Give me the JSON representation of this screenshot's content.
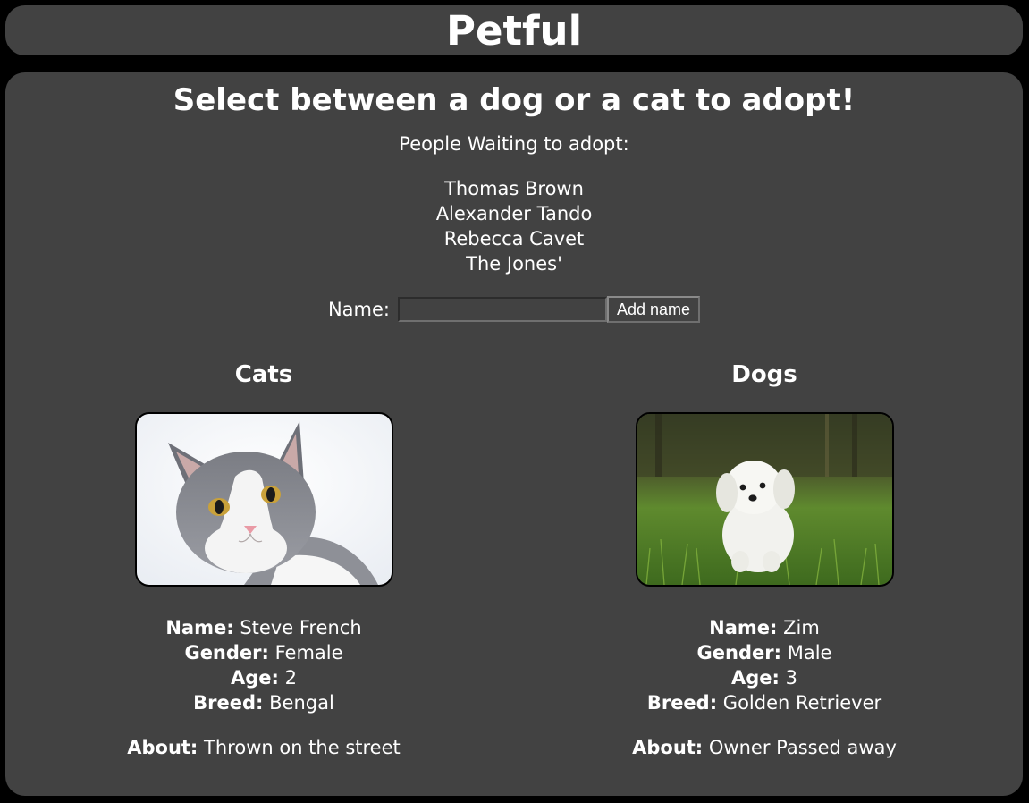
{
  "header": {
    "title": "Petful"
  },
  "main": {
    "heading": "Select between a dog or a cat to adopt!",
    "waiting_label": "People Waiting to adopt:",
    "queue": [
      "Thomas Brown",
      "Alexander Tando",
      "Rebecca Cavet",
      "The Jones'"
    ],
    "form": {
      "name_label": "Name:",
      "name_value": "",
      "add_button_label": "Add name"
    }
  },
  "labels": {
    "name": "Name:",
    "gender": "Gender:",
    "age": "Age:",
    "breed": "Breed:",
    "about": "About:"
  },
  "cats": {
    "heading": "Cats",
    "pet": {
      "name": "Steve French",
      "gender": "Female",
      "age": "2",
      "breed": "Bengal",
      "about": "Thrown on the street"
    }
  },
  "dogs": {
    "heading": "Dogs",
    "pet": {
      "name": "Zim",
      "gender": "Male",
      "age": "3",
      "breed": "Golden Retriever",
      "about": "Owner Passed away"
    }
  },
  "colors": {
    "page_background": "#000000",
    "panel_background": "#424242",
    "text": "#ffffff"
  }
}
